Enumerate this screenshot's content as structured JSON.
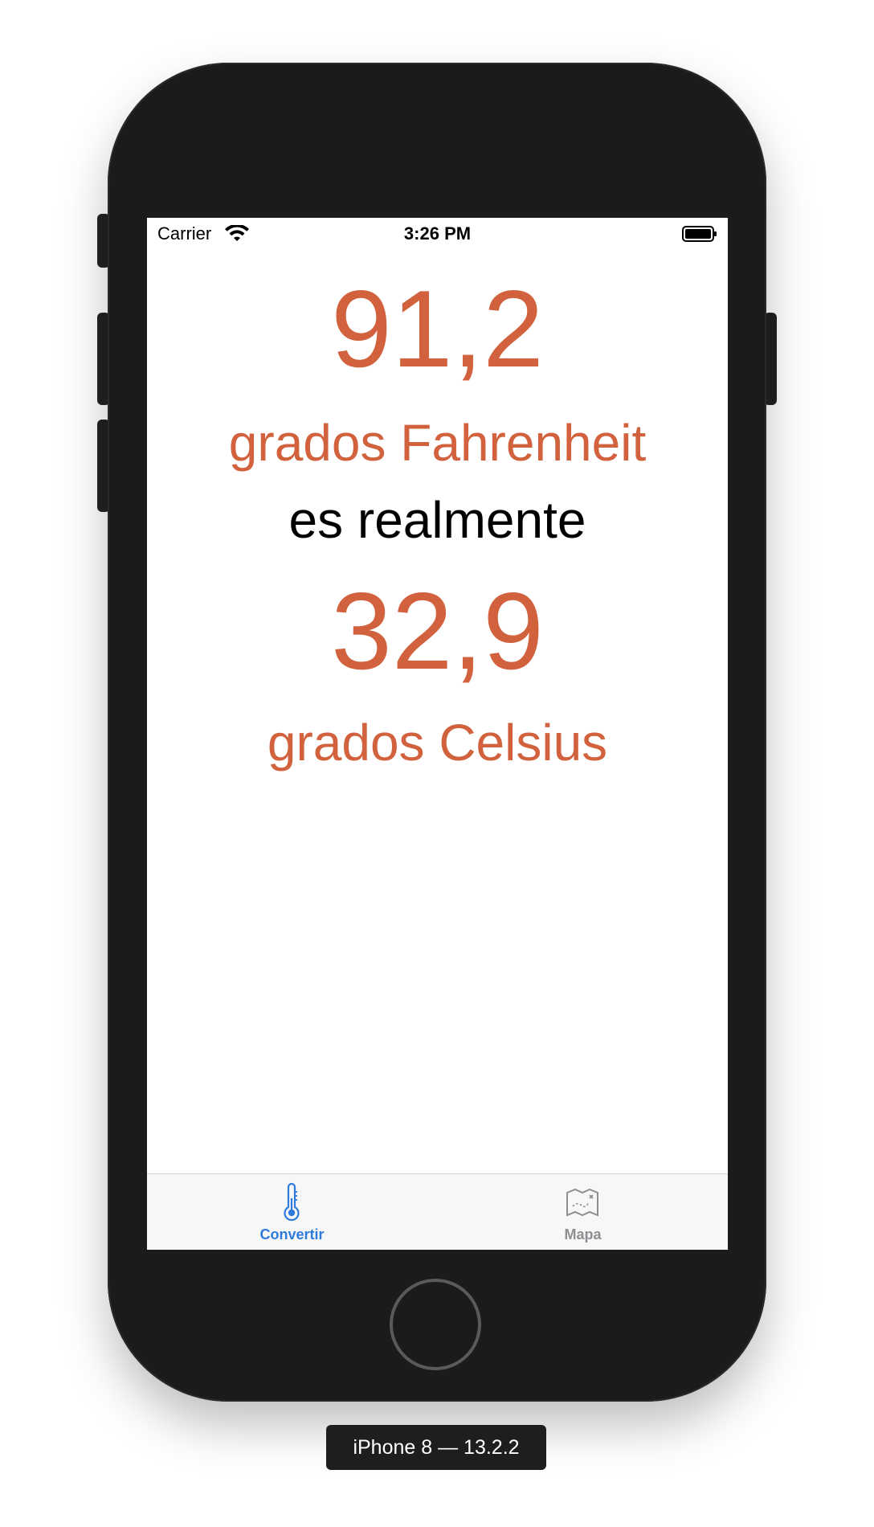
{
  "status_bar": {
    "carrier": "Carrier",
    "time": "3:26 PM",
    "wifi_icon": "wifi-icon",
    "battery_icon": "battery-icon"
  },
  "conversion": {
    "fahrenheit_value": "91,2",
    "fahrenheit_unit": "grados Fahrenheit",
    "connector": "es realmente",
    "celsius_value": "32,9",
    "celsius_unit": "grados Celsius"
  },
  "tab_bar": {
    "tabs": [
      {
        "label": "Convertir",
        "icon": "thermometer-icon",
        "selected": true
      },
      {
        "label": "Mapa",
        "icon": "map-icon",
        "selected": false
      }
    ]
  },
  "device_label": "iPhone 8 — 13.2.2",
  "colors": {
    "accent": "#d2623d",
    "tab_selected": "#2e7bdc",
    "tab_unselected": "#8e8e93",
    "device_body": "#1b1b1b"
  }
}
